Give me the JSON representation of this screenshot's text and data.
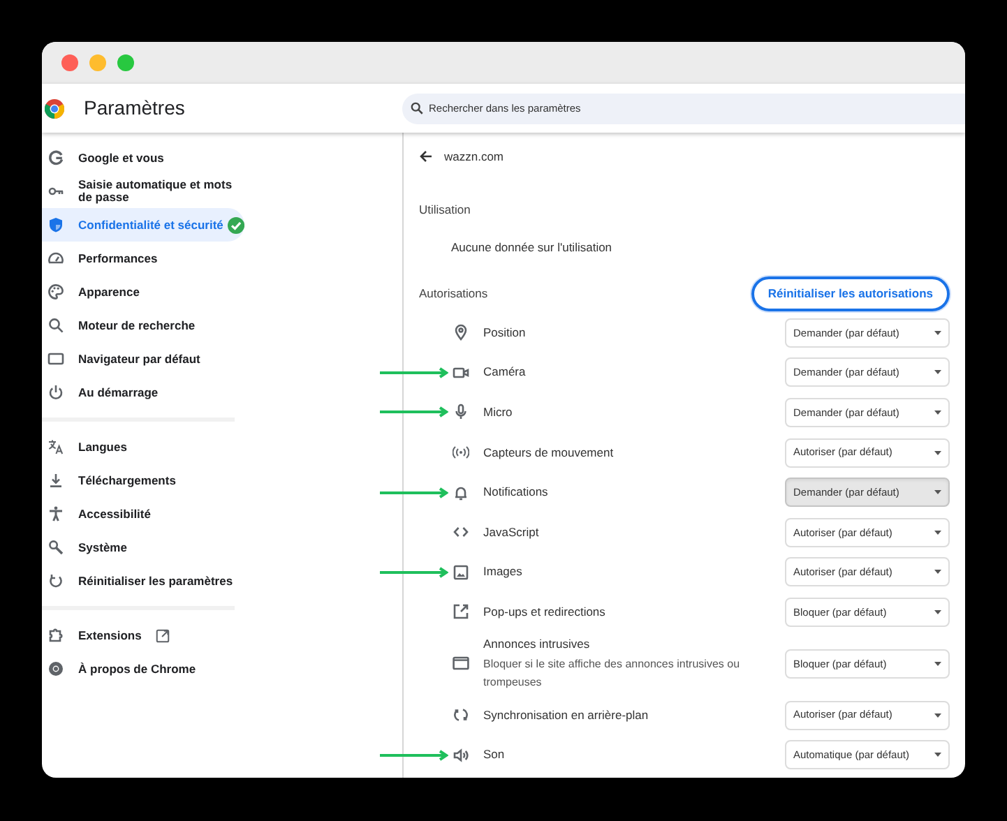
{
  "header": {
    "title": "Paramètres",
    "search": {
      "placeholder": "Rechercher dans les paramètres"
    }
  },
  "sidebar": {
    "groups": [
      {
        "items": [
          {
            "label": "Google et vous",
            "selected": false,
            "kind": "page",
            "check_badge": false
          },
          {
            "label": "Saisie automatique et mots de passe",
            "selected": false,
            "kind": "page",
            "check_badge": false
          },
          {
            "label": "Confidentialité et sécurité",
            "selected": true,
            "kind": "page",
            "check_badge": true
          },
          {
            "label": "Performances",
            "selected": false,
            "kind": "page",
            "check_badge": false
          },
          {
            "label": "Apparence",
            "selected": false,
            "kind": "page",
            "check_badge": false
          },
          {
            "label": "Moteur de recherche",
            "selected": false,
            "kind": "page",
            "check_badge": false
          },
          {
            "label": "Navigateur par défaut",
            "selected": false,
            "kind": "page",
            "check_badge": false
          },
          {
            "label": "Au démarrage",
            "selected": false,
            "kind": "page",
            "check_badge": false
          }
        ]
      },
      {
        "items": [
          {
            "label": "Langues",
            "selected": false,
            "kind": "page",
            "check_badge": false
          },
          {
            "label": "Téléchargements",
            "selected": false,
            "kind": "page",
            "check_badge": false
          },
          {
            "label": "Accessibilité",
            "selected": false,
            "kind": "page",
            "check_badge": false
          },
          {
            "label": "Système",
            "selected": false,
            "kind": "page",
            "check_badge": false
          },
          {
            "label": "Réinitialiser les paramètres",
            "selected": false,
            "kind": "page",
            "check_badge": false
          }
        ]
      },
      {
        "items": [
          {
            "label": "Extensions",
            "selected": false,
            "kind": "external",
            "check_badge": false
          },
          {
            "label": "À propos de Chrome",
            "selected": false,
            "kind": "page",
            "check_badge": false
          }
        ]
      }
    ]
  },
  "main": {
    "site": "wazzn.com",
    "usage": {
      "heading": "Utilisation",
      "text": "Aucune donnée sur l'utilisation"
    },
    "permissions": {
      "heading": "Autorisations",
      "reset_button": "Réinitialiser les autorisations",
      "rows": [
        {
          "label": "Position",
          "value": "Demander (par défaut)",
          "hovered": false,
          "arrow": false
        },
        {
          "label": "Caméra",
          "value": "Demander (par défaut)",
          "hovered": false,
          "arrow": true
        },
        {
          "label": "Micro",
          "value": "Demander (par défaut)",
          "hovered": false,
          "arrow": true
        },
        {
          "label": "Capteurs de mouvement",
          "value": "Autoriser (par défaut)",
          "hovered": false,
          "arrow": false
        },
        {
          "label": "Notifications",
          "value": "Demander (par défaut)",
          "hovered": true,
          "arrow": true
        },
        {
          "label": "JavaScript",
          "value": "Autoriser (par défaut)",
          "hovered": false,
          "arrow": false
        },
        {
          "label": "Images",
          "value": "Autoriser (par défaut)",
          "hovered": false,
          "arrow": true
        },
        {
          "label": "Pop-ups et redirections",
          "value": "Bloquer (par défaut)",
          "hovered": false,
          "arrow": false
        },
        {
          "label": "Annonces intrusives",
          "description": "Bloquer si le site affiche des annonces intrusives ou trompeuses",
          "value": "Bloquer (par défaut)",
          "hovered": false,
          "arrow": false
        },
        {
          "label": "Synchronisation en arrière-plan",
          "value": "Autoriser (par défaut)",
          "hovered": false,
          "arrow": false
        },
        {
          "label": "Son",
          "value": "Automatique (par défaut)",
          "hovered": false,
          "arrow": true
        }
      ]
    }
  }
}
